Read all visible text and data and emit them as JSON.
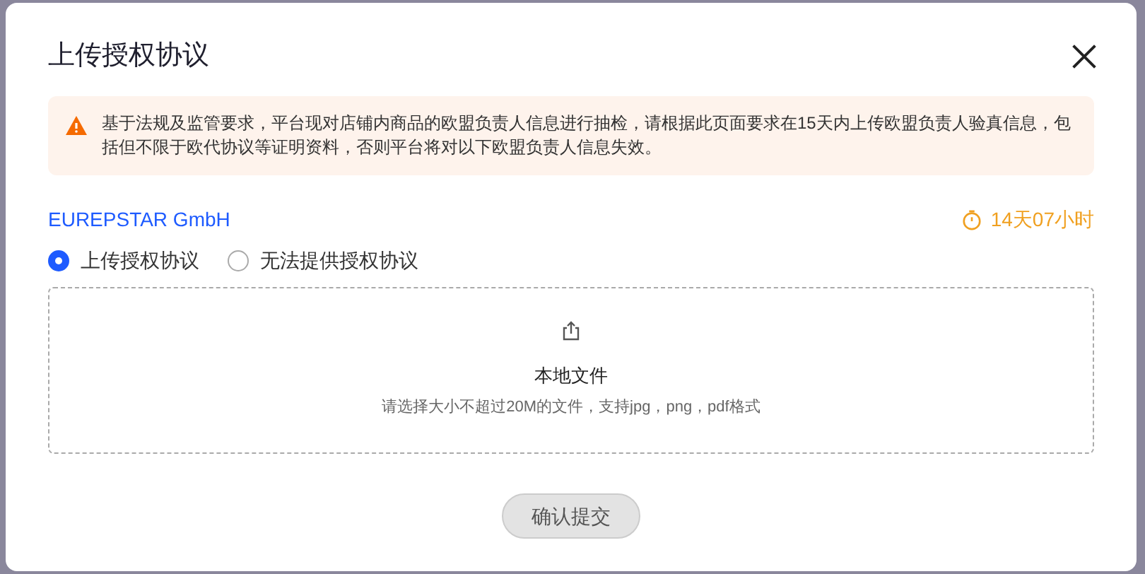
{
  "dialog": {
    "title": "上传授权协议"
  },
  "alert": {
    "text": "基于法规及监管要求，平台现对店铺内商品的欧盟负责人信息进行抽检，请根据此页面要求在15天内上传欧盟负责人验真信息，包括但不限于欧代协议等证明资料，否则平台将对以下欧盟负责人信息失效。"
  },
  "company": {
    "name": "EUREPSTAR GmbH",
    "countdown": "14天07小时"
  },
  "options": [
    {
      "label": "上传授权协议",
      "selected": true
    },
    {
      "label": "无法提供授权协议",
      "selected": false
    }
  ],
  "upload": {
    "title": "本地文件",
    "hint": "请选择大小不超过20M的文件，支持jpg，png，pdf格式"
  },
  "submit": {
    "label": "确认提交",
    "disabled": true
  }
}
